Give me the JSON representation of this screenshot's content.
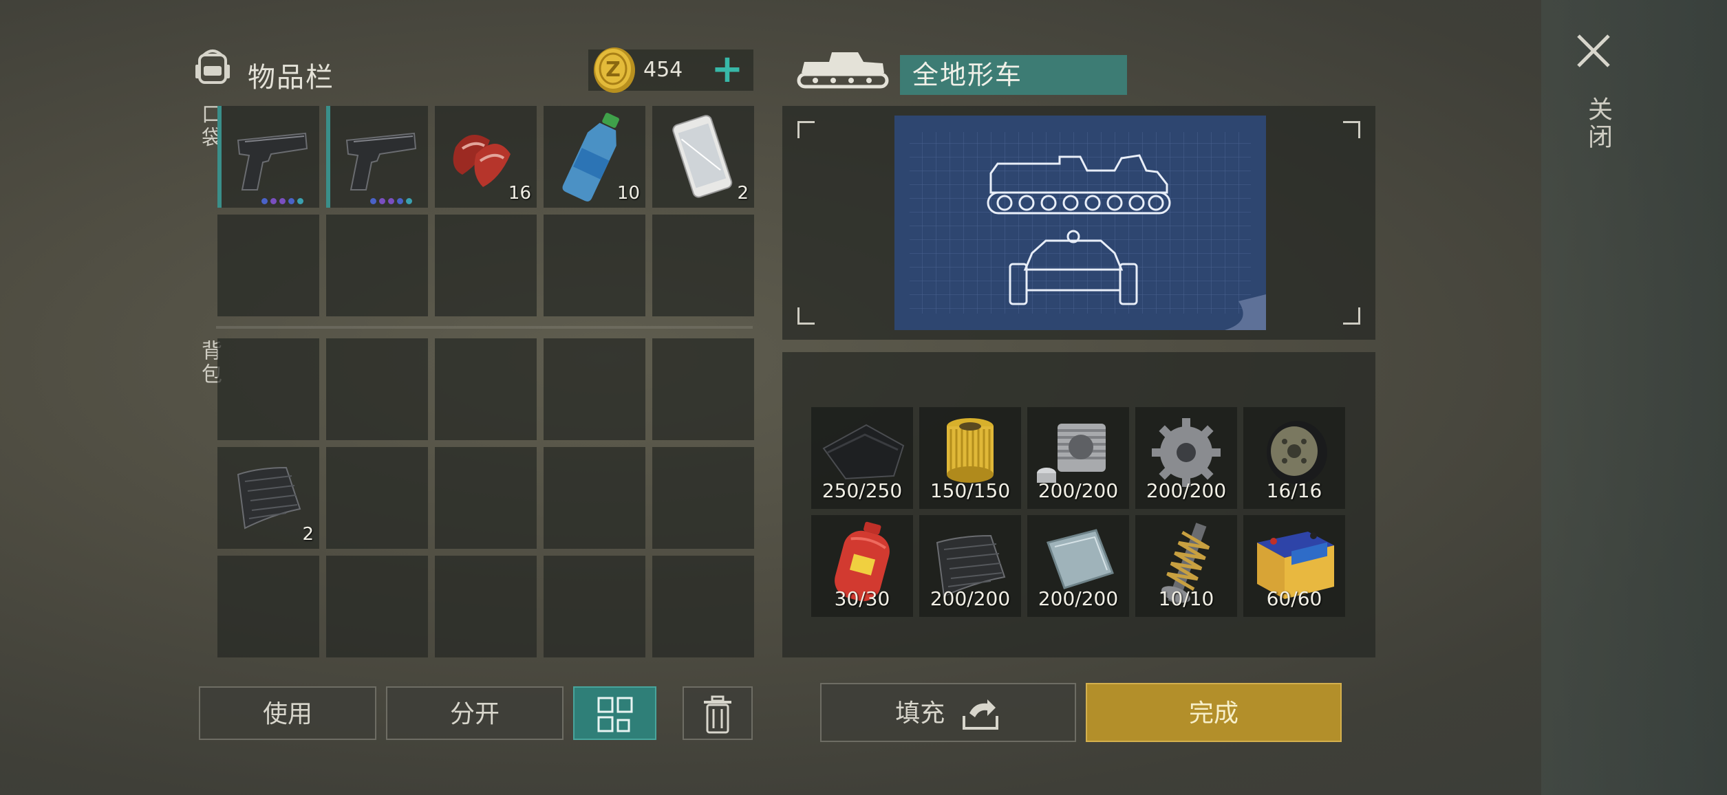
{
  "inventory": {
    "title": "物品栏",
    "coins": "454",
    "pocket_label": "口袋",
    "backpack_label": "背包",
    "pocket_slots": [
      {
        "item": "pistol-icon",
        "count": "",
        "equipped": true
      },
      {
        "item": "pistol-icon",
        "count": "",
        "equipped": true
      },
      {
        "item": "meat-icon",
        "count": "16"
      },
      {
        "item": "water-bottle-icon",
        "count": "10"
      },
      {
        "item": "smartphone-icon",
        "count": "2"
      }
    ],
    "backpack_item": {
      "item": "rubber-sheet-icon",
      "count": "2"
    }
  },
  "buttons": {
    "use": "使用",
    "split": "分开",
    "fill": "填充",
    "done": "完成"
  },
  "vehicle": {
    "name": "全地形车",
    "requirements": [
      {
        "item": "fabric-icon",
        "count": "250/250"
      },
      {
        "item": "oil-filter-icon",
        "count": "150/150"
      },
      {
        "item": "engine-cylinder-icon",
        "count": "200/200"
      },
      {
        "item": "gear-icon",
        "count": "200/200"
      },
      {
        "item": "wheel-rim-icon",
        "count": "16/16"
      },
      {
        "item": "gas-canister-icon",
        "count": "30/30"
      },
      {
        "item": "rubber-sheet-icon",
        "count": "200/200"
      },
      {
        "item": "metal-plate-icon",
        "count": "200/200"
      },
      {
        "item": "spring-shock-icon",
        "count": "10/10"
      },
      {
        "item": "car-battery-icon",
        "count": "60/60"
      }
    ]
  },
  "close_label": "关闭",
  "colors": {
    "accent_teal": "#3d7c74",
    "gold": "#b38f2a",
    "blueprint": "#2e4670"
  }
}
